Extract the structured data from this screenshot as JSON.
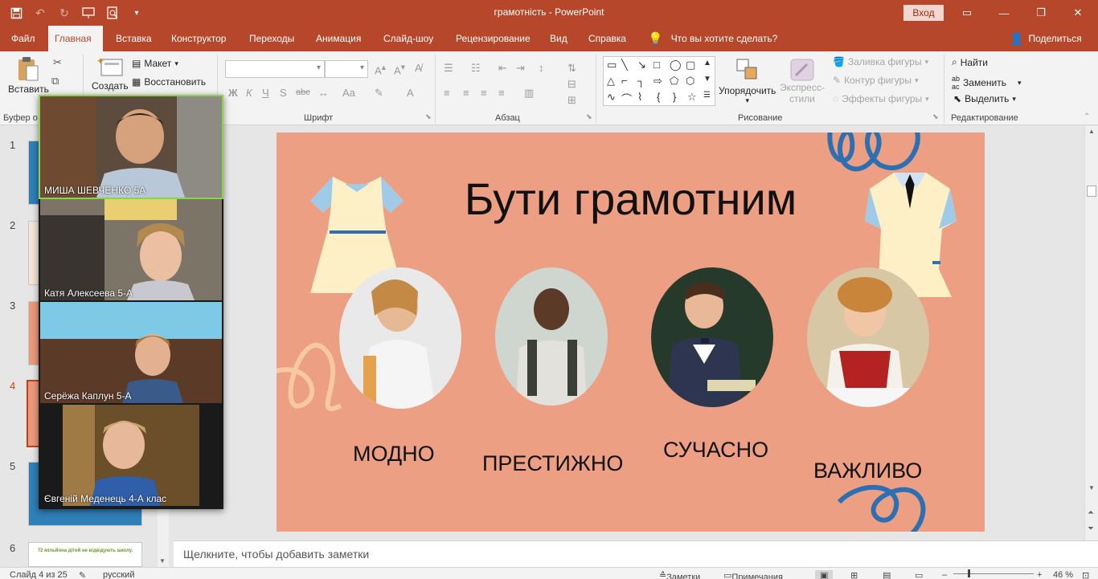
{
  "window": {
    "title": "грамотність  -  PowerPoint",
    "signin": "Вход"
  },
  "qat": [
    "save-icon",
    "undo-icon",
    "redo-icon",
    "present-icon",
    "print-preview-icon",
    "customize-icon"
  ],
  "tabs": [
    "Файл",
    "Главная",
    "Вставка",
    "Конструктор",
    "Переходы",
    "Анимация",
    "Слайд-шоу",
    "Рецензирование",
    "Вид",
    "Справка"
  ],
  "active_tab": "Главная",
  "tell_me": "Что вы хотите сделать?",
  "share": "Поделиться",
  "ribbon": {
    "clipboard": {
      "paste": "Вставить",
      "label": "Буфер о"
    },
    "slides": {
      "create": "Создать",
      "layout": "Макет",
      "reset": "Восстановить"
    },
    "font": {
      "label": "Шрифт",
      "bold": "Ж",
      "italic": "К",
      "underline": "Ч",
      "shadow": "S",
      "strike": "abc",
      "case": "Aa",
      "color": "A"
    },
    "paragraph": {
      "label": "Абзац"
    },
    "drawing": {
      "label": "Рисование",
      "arrange": "Упорядочить",
      "quick_styles_1": "Экспресс-",
      "quick_styles_2": "стили",
      "fill": "Заливка фигуры",
      "outline": "Контур фигуры",
      "effects": "Эффекты фигуры"
    },
    "editing": {
      "label": "Редактирование",
      "find": "Найти",
      "replace": "Заменить",
      "select": "Выделить"
    }
  },
  "slide_numbers": [
    "1",
    "2",
    "3",
    "4",
    "5",
    "6"
  ],
  "thumb6_text": "72 мільйона дітей не відвідують школу.",
  "zoom_participants": [
    {
      "name": "МИША ШЕВЧЕНКО 5А"
    },
    {
      "name": "Катя Алексеева 5-А"
    },
    {
      "name": "Серёжа Каплун 5-А"
    },
    {
      "name": "Євгеній Меденець 4-А клас"
    }
  ],
  "slide": {
    "title": "Бути грамотним",
    "words": [
      "МОДНО",
      "ПРЕСТИЖНО",
      "СУЧАСНО",
      "ВАЖЛИВО"
    ],
    "background": "#ec9f82"
  },
  "notes_placeholder": "Щелкните, чтобы добавить заметки",
  "status": {
    "slide_info": "Слайд 4 из 25",
    "language": "русский",
    "notes": "Заметки",
    "comments": "Примечания",
    "zoom": "46 %"
  },
  "colors": {
    "accent": "#b7472a"
  }
}
